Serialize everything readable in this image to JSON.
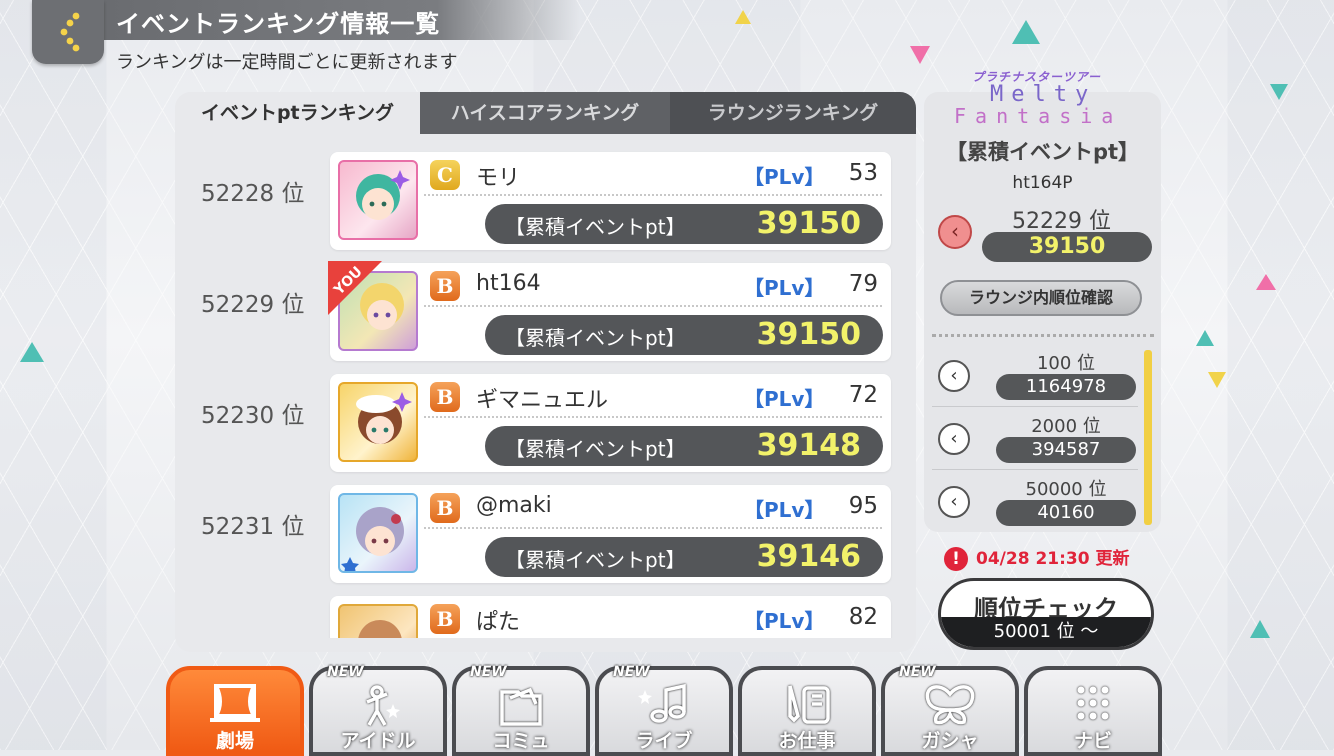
{
  "header": {
    "title": "イベントランキング情報一覧",
    "subtitle": "ランキングは一定時間ごとに更新されます"
  },
  "tabs": [
    {
      "label": "イベントptランキング",
      "active": true
    },
    {
      "label": "ハイスコアランキング",
      "active": false
    },
    {
      "label": "ラウンジランキング",
      "active": false
    }
  ],
  "rows": [
    {
      "rank": "52228 位",
      "grade": "C",
      "name": "モリ",
      "plv_label": "【PLv】",
      "plv": "53",
      "pt_label": "【累積イベントpt】",
      "pt": "39150",
      "is_you": false
    },
    {
      "rank": "52229 位",
      "grade": "B",
      "name": "ht164",
      "plv_label": "【PLv】",
      "plv": "79",
      "pt_label": "【累積イベントpt】",
      "pt": "39150",
      "is_you": true,
      "you_label": "YOU"
    },
    {
      "rank": "52230 位",
      "grade": "B",
      "name": "ギマニュエル",
      "plv_label": "【PLv】",
      "plv": "72",
      "pt_label": "【累積イベントpt】",
      "pt": "39148",
      "is_you": false
    },
    {
      "rank": "52231 位",
      "grade": "B",
      "name": "@maki",
      "plv_label": "【PLv】",
      "plv": "95",
      "pt_label": "【累積イベントpt】",
      "pt": "39146",
      "is_you": false
    },
    {
      "rank": "",
      "grade": "B",
      "name": "ぱた",
      "plv_label": "【PLv】",
      "plv": "82",
      "pt_label": "【累積イベントpt】",
      "pt": "",
      "is_you": false
    }
  ],
  "side": {
    "logo_top": "プラチナスターツアー",
    "logo_line1": "Melty",
    "logo_line2": "Fantasia",
    "heading": "【累積イベントpt】",
    "user": "ht164P",
    "my_rank": "52229 位",
    "my_pt": "39150",
    "lounge_button": "ラウンジ内順位確認",
    "borders": [
      {
        "rank": "100 位",
        "pt": "1164978"
      },
      {
        "rank": "2000 位",
        "pt": "394587"
      },
      {
        "rank": "50000 位",
        "pt": "40160"
      }
    ],
    "update_text": "04/28 21:30 更新",
    "check_label": "順位チェック",
    "check_sub": "50001 位 ～"
  },
  "nav": [
    {
      "label": "劇場",
      "icon": "theater-icon",
      "active": true,
      "new": false
    },
    {
      "label": "アイドル",
      "icon": "idol-icon",
      "active": false,
      "new": true
    },
    {
      "label": "コミュ",
      "icon": "commu-icon",
      "active": false,
      "new": true
    },
    {
      "label": "ライブ",
      "icon": "music-note-icon",
      "active": false,
      "new": true
    },
    {
      "label": "お仕事",
      "icon": "work-icon",
      "active": false,
      "new": false
    },
    {
      "label": "ガシャ",
      "icon": "gacha-icon",
      "active": false,
      "new": true
    },
    {
      "label": "ナビ",
      "icon": "menu-grid-icon",
      "active": false,
      "new": false
    }
  ],
  "new_tag": "NEW",
  "colors": {
    "accent_orange": "#f05a14",
    "pt_yellow": "#f2f26a",
    "plv_blue": "#2f6fd1",
    "alert_red": "#e0243a"
  }
}
